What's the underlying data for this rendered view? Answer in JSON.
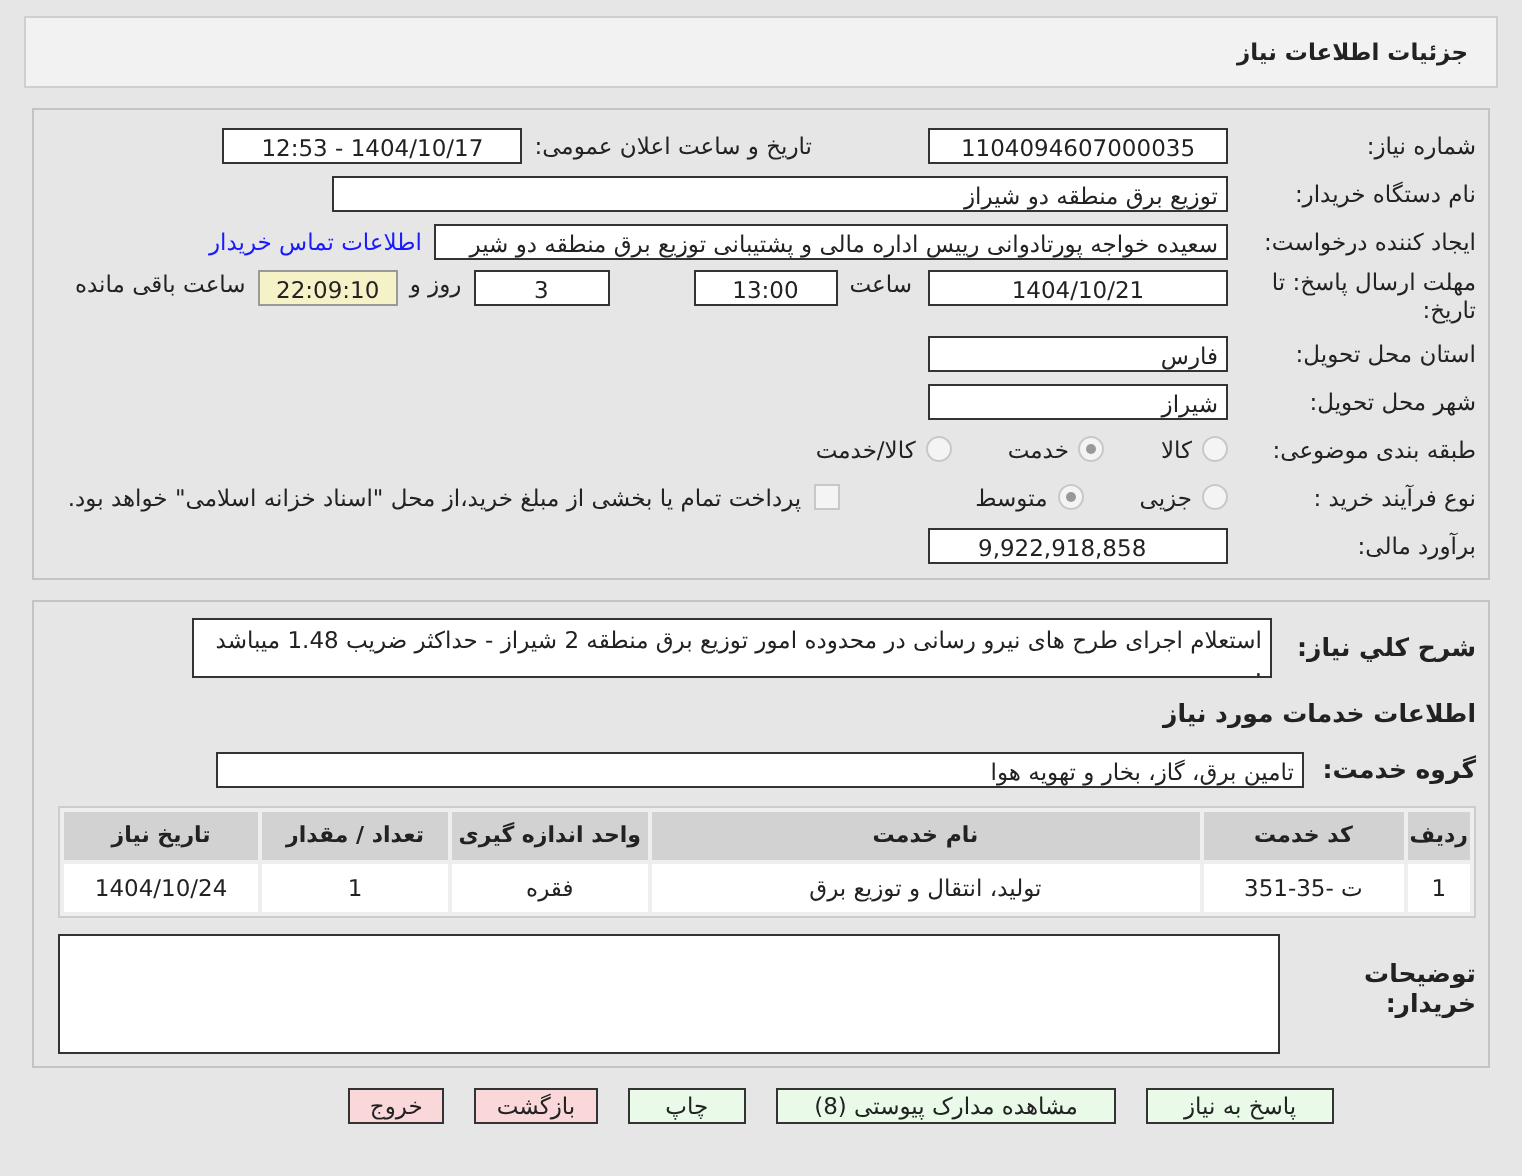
{
  "header": {
    "title": "جزئیات اطلاعات نیاز"
  },
  "need_number": {
    "label": "شماره نیاز:",
    "value": "1104094607000035"
  },
  "announce": {
    "label": "تاریخ و ساعت اعلان عمومی:",
    "value": "1404/10/17 - 12:53"
  },
  "buyer": {
    "label": "نام دستگاه خریدار:",
    "value": "توزیع برق منطقه دو شیراز"
  },
  "creator": {
    "label": "ایجاد کننده درخواست:",
    "value": "سعیده خواجه پورتادوانی رییس اداره مالی و پشتیبانی  توزیع برق منطقه دو شیر",
    "link": "اطلاعات تماس خریدار"
  },
  "deadline": {
    "label": "مهلت ارسال پاسخ: تا تاریخ:",
    "date": "1404/10/21",
    "time_label": "ساعت",
    "time": "13:00",
    "days": "3",
    "days_label": "روز و",
    "remaining": "22:09:10",
    "remaining_label": "ساعت باقی مانده"
  },
  "province": {
    "label": "استان محل تحویل:",
    "value": "فارس"
  },
  "city": {
    "label": "شهر محل تحویل:",
    "value": "شیراز"
  },
  "category": {
    "label": "طبقه بندی موضوعی:",
    "options": [
      {
        "label": "کالا",
        "selected": false
      },
      {
        "label": "خدمت",
        "selected": true
      },
      {
        "label": "کالا/خدمت",
        "selected": false
      }
    ]
  },
  "process": {
    "label": "نوع فرآیند خرید :",
    "options": [
      {
        "label": "جزیی",
        "selected": false
      },
      {
        "label": "متوسط",
        "selected": true
      }
    ],
    "treasury": {
      "label": "پرداخت تمام یا بخشی از مبلغ خرید،از محل \"اسناد خزانه اسلامی\" خواهد بود.",
      "checked": false
    }
  },
  "budget": {
    "label": "برآورد مالی:",
    "value": "9,922,918,858"
  },
  "description": {
    "label": "شرح کلي نياز:",
    "value": "استعلام اجرای طرح های نیرو رسانی در محدوده امور توزیع برق منطقه 2 شیراز - حداکثر ضریب 1.48 میباشد ."
  },
  "services_title": "اطلاعات خدمات مورد نیاز",
  "service_group": {
    "label": "گروه خدمت:",
    "value": "تامین برق، گاز، بخار و تهویه هوا"
  },
  "table": {
    "columns": [
      "ردیف",
      "کد خدمت",
      "نام خدمت",
      "واحد اندازه گیری",
      "تعداد / مقدار",
      "تاریخ نیاز"
    ],
    "rows": [
      [
        "1",
        "ت -35-351",
        "تولید، انتقال و توزیع برق",
        "فقره",
        "1",
        "1404/10/24"
      ]
    ]
  },
  "buyer_notes": {
    "label": "توضیحات خریدار:"
  },
  "buttons": [
    {
      "label": "پاسخ به نیاز",
      "kind": "primary"
    },
    {
      "label": "مشاهده مدارک پیوستی (8)",
      "kind": "primary"
    },
    {
      "label": "چاپ",
      "kind": "primary"
    },
    {
      "label": "بازگشت",
      "kind": "danger"
    },
    {
      "label": "خروج",
      "kind": "danger"
    }
  ]
}
